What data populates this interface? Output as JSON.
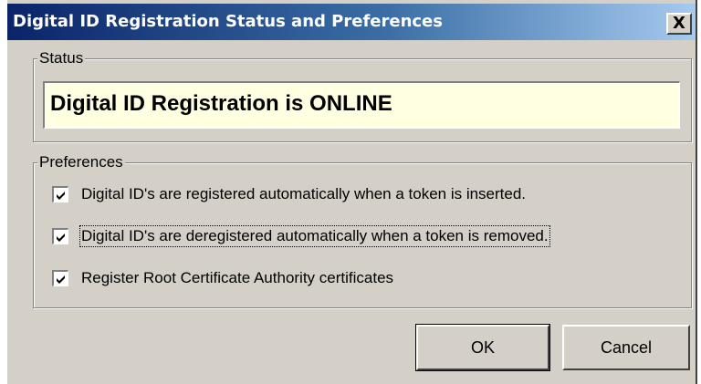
{
  "window": {
    "title": "Digital ID Registration Status and Preferences",
    "close_glyph": "X"
  },
  "status": {
    "legend": "Status",
    "text": "Digital ID Registration is ONLINE"
  },
  "preferences": {
    "legend": "Preferences",
    "items": [
      {
        "label": "Digital ID's are registered automatically when a token is inserted.",
        "checked": true
      },
      {
        "label": "Digital ID's are deregistered automatically when a token is removed.",
        "checked": true
      },
      {
        "label": "Register Root Certificate Authority certificates",
        "checked": true
      }
    ]
  },
  "buttons": {
    "ok": "OK",
    "cancel": "Cancel"
  }
}
